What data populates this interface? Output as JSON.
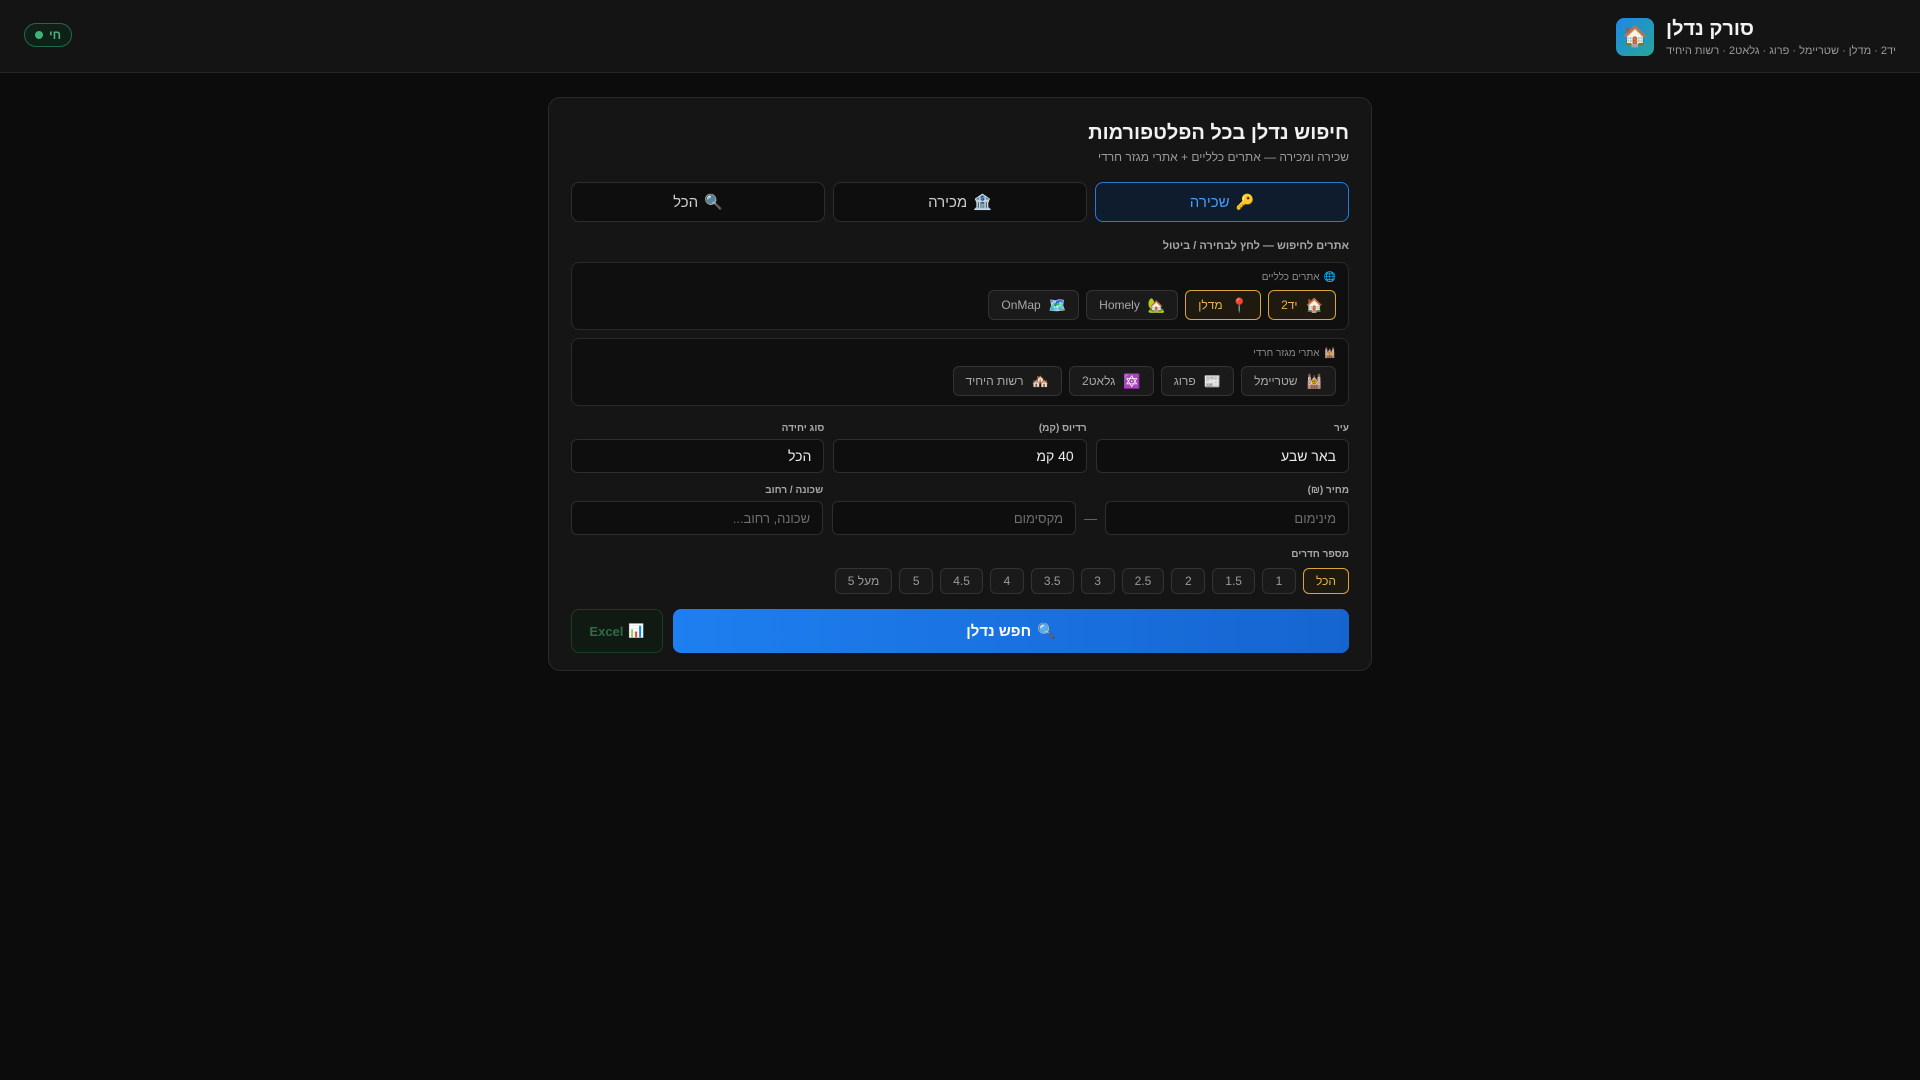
{
  "header": {
    "logo_icon": "house-emoji",
    "logo_glyph": "🏠",
    "title": "סורק נדלן",
    "subtitle": "יד2 · מדלן · שטריימל · פרוג · גלאט2 · רשות היחיד",
    "live_label": "חי",
    "live_color": "#3fb27a"
  },
  "card": {
    "title": "חיפוש נדלן בכל הפלטפורמות",
    "subtitle": "שכירה ומכירה — אתרים כלליים + אתרי מגזר חרדי"
  },
  "modes": [
    {
      "label": "שכירה",
      "icon": "🔑",
      "active": true
    },
    {
      "label": "מכירה",
      "icon": "🏦",
      "active": false
    },
    {
      "label": "הכל",
      "icon": "🔍",
      "active": false
    }
  ],
  "sites_label": "אתרים לחיפוש — לחץ לבחירה / ביטול",
  "general_sites": {
    "title": "אתרים כלליים",
    "icon": "🌐",
    "items": [
      {
        "label": "יד2",
        "icon": "🏠",
        "selected": true
      },
      {
        "label": "מדלן",
        "icon": "📍",
        "selected": true
      },
      {
        "label": "Homely",
        "icon": "🏡",
        "selected": false
      },
      {
        "label": "OnMap",
        "icon": "🗺️",
        "selected": false
      }
    ]
  },
  "haredi_sites": {
    "title": "אתרי מגזר חרדי",
    "icon": "🕍",
    "items": [
      {
        "label": "שטריימל",
        "icon": "🕍",
        "selected": false
      },
      {
        "label": "פרוג",
        "icon": "📰",
        "selected": false
      },
      {
        "label": "גלאט2",
        "icon": "🔯",
        "selected": false
      },
      {
        "label": "רשות היחיד",
        "icon": "🏘️",
        "selected": false
      }
    ]
  },
  "fields": {
    "city": {
      "label": "עיר",
      "value": "באר שבע"
    },
    "radius": {
      "label": "רדיוס (קמ)",
      "value": "40 קמ"
    },
    "unit_type": {
      "label": "סוג יחידה",
      "value": "הכל"
    },
    "price": {
      "label": "מחיר (₪)",
      "min_placeholder": "מינימום",
      "max_placeholder": "מקסימום",
      "separator": "—"
    },
    "neighborhood": {
      "label": "שכונה / רחוב",
      "placeholder": "שכונה, רחוב..."
    }
  },
  "rooms": {
    "label": "מספר חדרים",
    "options": [
      "הכל",
      "1",
      "1.5",
      "2",
      "2.5",
      "3",
      "3.5",
      "4",
      "4.5",
      "5",
      "מעל 5"
    ],
    "selected": "הכל"
  },
  "actions": {
    "search_label": "חפש נדלן",
    "search_icon": "🔍",
    "excel_label": "Excel",
    "excel_icon": "📊"
  },
  "colors": {
    "accent_blue": "#1e7ff0",
    "selected_gold": "#e6b450",
    "background": "#0c0c0c"
  }
}
